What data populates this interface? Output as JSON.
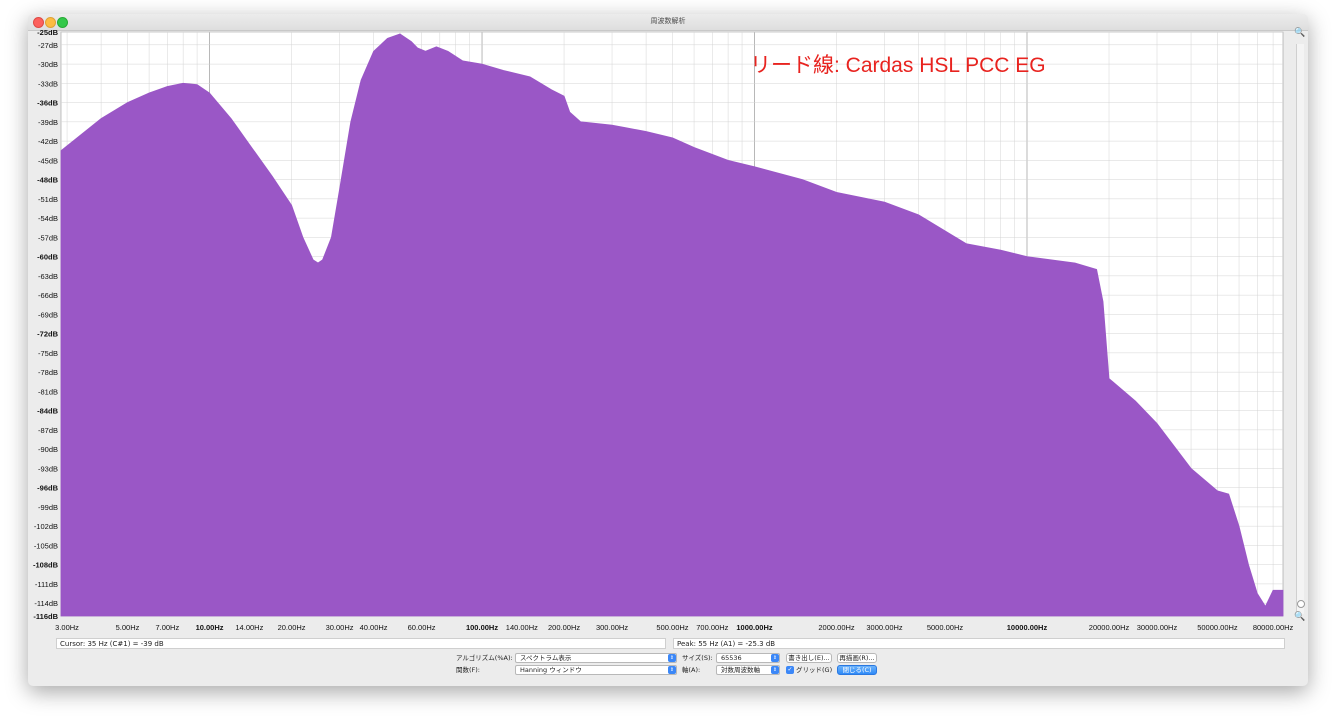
{
  "window": {
    "title": "周波数解析"
  },
  "overlay_label": "リード線: Cardas HSL PCC EG",
  "colors": {
    "fill": "#9a57c6",
    "overlay_text": "#e8231f",
    "grid": "#d4d4d4",
    "grid_major": "#b0b0b0"
  },
  "chart_data": {
    "type": "area",
    "title": "",
    "xlabel": "",
    "ylabel": "",
    "x_scale": "log",
    "xlim": [
      2.85,
      87000
    ],
    "ylim": [
      -116,
      -25
    ],
    "y_tick_labels": [
      {
        "v": -25,
        "t": "-25dB",
        "bold": true
      },
      {
        "v": -27,
        "t": "-27dB",
        "bold": false
      },
      {
        "v": -30,
        "t": "-30dB",
        "bold": false
      },
      {
        "v": -33,
        "t": "-33dB",
        "bold": false
      },
      {
        "v": -36,
        "t": "-36dB",
        "bold": true
      },
      {
        "v": -39,
        "t": "-39dB",
        "bold": false
      },
      {
        "v": -42,
        "t": "-42dB",
        "bold": false
      },
      {
        "v": -45,
        "t": "-45dB",
        "bold": false
      },
      {
        "v": -48,
        "t": "-48dB",
        "bold": true
      },
      {
        "v": -51,
        "t": "-51dB",
        "bold": false
      },
      {
        "v": -54,
        "t": "-54dB",
        "bold": false
      },
      {
        "v": -57,
        "t": "-57dB",
        "bold": false
      },
      {
        "v": -60,
        "t": "-60dB",
        "bold": true
      },
      {
        "v": -63,
        "t": "-63dB",
        "bold": false
      },
      {
        "v": -66,
        "t": "-66dB",
        "bold": false
      },
      {
        "v": -69,
        "t": "-69dB",
        "bold": false
      },
      {
        "v": -72,
        "t": "-72dB",
        "bold": true
      },
      {
        "v": -75,
        "t": "-75dB",
        "bold": false
      },
      {
        "v": -78,
        "t": "-78dB",
        "bold": false
      },
      {
        "v": -81,
        "t": "-81dB",
        "bold": false
      },
      {
        "v": -84,
        "t": "-84dB",
        "bold": true
      },
      {
        "v": -87,
        "t": "-87dB",
        "bold": false
      },
      {
        "v": -90,
        "t": "-90dB",
        "bold": false
      },
      {
        "v": -93,
        "t": "-93dB",
        "bold": false
      },
      {
        "v": -96,
        "t": "-96dB",
        "bold": true
      },
      {
        "v": -99,
        "t": "-99dB",
        "bold": false
      },
      {
        "v": -102,
        "t": "-102dB",
        "bold": false
      },
      {
        "v": -105,
        "t": "-105dB",
        "bold": false
      },
      {
        "v": -108,
        "t": "-108dB",
        "bold": true
      },
      {
        "v": -111,
        "t": "-111dB",
        "bold": false
      },
      {
        "v": -114,
        "t": "-114dB",
        "bold": false
      },
      {
        "v": -116,
        "t": "-116dB",
        "bold": true
      }
    ],
    "x_tick_labels": [
      {
        "v": 3,
        "t": "3.00Hz",
        "bold": false
      },
      {
        "v": 5,
        "t": "5.00Hz",
        "bold": false
      },
      {
        "v": 7,
        "t": "7.00Hz",
        "bold": false
      },
      {
        "v": 10,
        "t": "10.00Hz",
        "bold": true
      },
      {
        "v": 14,
        "t": "14.00Hz",
        "bold": false
      },
      {
        "v": 20,
        "t": "20.00Hz",
        "bold": false
      },
      {
        "v": 30,
        "t": "30.00Hz",
        "bold": false
      },
      {
        "v": 40,
        "t": "40.00Hz",
        "bold": false
      },
      {
        "v": 60,
        "t": "60.00Hz",
        "bold": false
      },
      {
        "v": 100,
        "t": "100.00Hz",
        "bold": true
      },
      {
        "v": 140,
        "t": "140.00Hz",
        "bold": false
      },
      {
        "v": 200,
        "t": "200.00Hz",
        "bold": false
      },
      {
        "v": 300,
        "t": "300.00Hz",
        "bold": false
      },
      {
        "v": 500,
        "t": "500.00Hz",
        "bold": false
      },
      {
        "v": 700,
        "t": "700.00Hz",
        "bold": false
      },
      {
        "v": 1000,
        "t": "1000.00Hz",
        "bold": true
      },
      {
        "v": 2000,
        "t": "2000.00Hz",
        "bold": false
      },
      {
        "v": 3000,
        "t": "3000.00Hz",
        "bold": false
      },
      {
        "v": 5000,
        "t": "5000.00Hz",
        "bold": false
      },
      {
        "v": 10000,
        "t": "10000.00Hz",
        "bold": true
      },
      {
        "v": 20000,
        "t": "20000.00Hz",
        "bold": false
      },
      {
        "v": 30000,
        "t": "30000.00Hz",
        "bold": false
      },
      {
        "v": 50000,
        "t": "50000.00Hz",
        "bold": false
      },
      {
        "v": 80000,
        "t": "80000.00Hz",
        "bold": false
      }
    ],
    "series": [
      {
        "x": [
          2.85,
          4,
          5,
          6,
          7,
          8,
          9,
          10,
          12,
          14,
          17,
          20,
          22,
          24,
          25,
          26,
          28,
          30,
          33,
          36,
          40,
          45,
          50,
          55,
          58,
          62,
          68,
          75,
          85,
          100,
          120,
          150,
          180,
          200,
          210,
          230,
          300,
          400,
          500,
          600,
          800,
          1000,
          1500,
          2000,
          3000,
          4000,
          5000,
          6000,
          8000,
          10000,
          15000,
          18000,
          19000,
          20000,
          25000,
          30000,
          40000,
          50000,
          55000,
          60000,
          65000,
          70000,
          75000,
          80000,
          87000
        ],
        "y": [
          -43.5,
          -38.5,
          -36,
          -34.5,
          -33.5,
          -33,
          -33.2,
          -34.5,
          -38.5,
          -42.5,
          -47.5,
          -52,
          -57,
          -60.5,
          -61,
          -60.5,
          -57,
          -49.5,
          -39,
          -32.5,
          -28,
          -26,
          -25.3,
          -26.5,
          -27.5,
          -28,
          -27.3,
          -28,
          -29.5,
          -30,
          -31,
          -32,
          -34,
          -35,
          -37.5,
          -39,
          -39.5,
          -40.5,
          -41.5,
          -43,
          -45,
          -46,
          -48,
          -50,
          -51.5,
          -53.5,
          -56,
          -58,
          -59,
          -60,
          -61,
          -62,
          -67,
          -79,
          -82.5,
          -86,
          -93,
          -96.5,
          -97,
          -102,
          -108,
          -112.5,
          -114.5,
          -112,
          -112
        ]
      }
    ]
  },
  "cursor": {
    "label": "Cursor: 35 Hz (C#1) = -39 dB"
  },
  "peak": {
    "label": "Peak: 55 Hz (A1) = -25.3 dB"
  },
  "controls": {
    "algorithm_label": "アルゴリズム(%A):",
    "algorithm_value": "スペクトラム表示",
    "function_label": "関数(F):",
    "function_value": "Hanning ウィンドウ",
    "size_label": "サイズ(S):",
    "size_value": "65536",
    "axis_label": "軸(A):",
    "axis_value": "対数周波数軸",
    "export_label": "書き出し(E)...",
    "replot_label": "再描画(R)...",
    "grid_label": "グリッド(G)",
    "close_label": "閉じる(C)"
  }
}
